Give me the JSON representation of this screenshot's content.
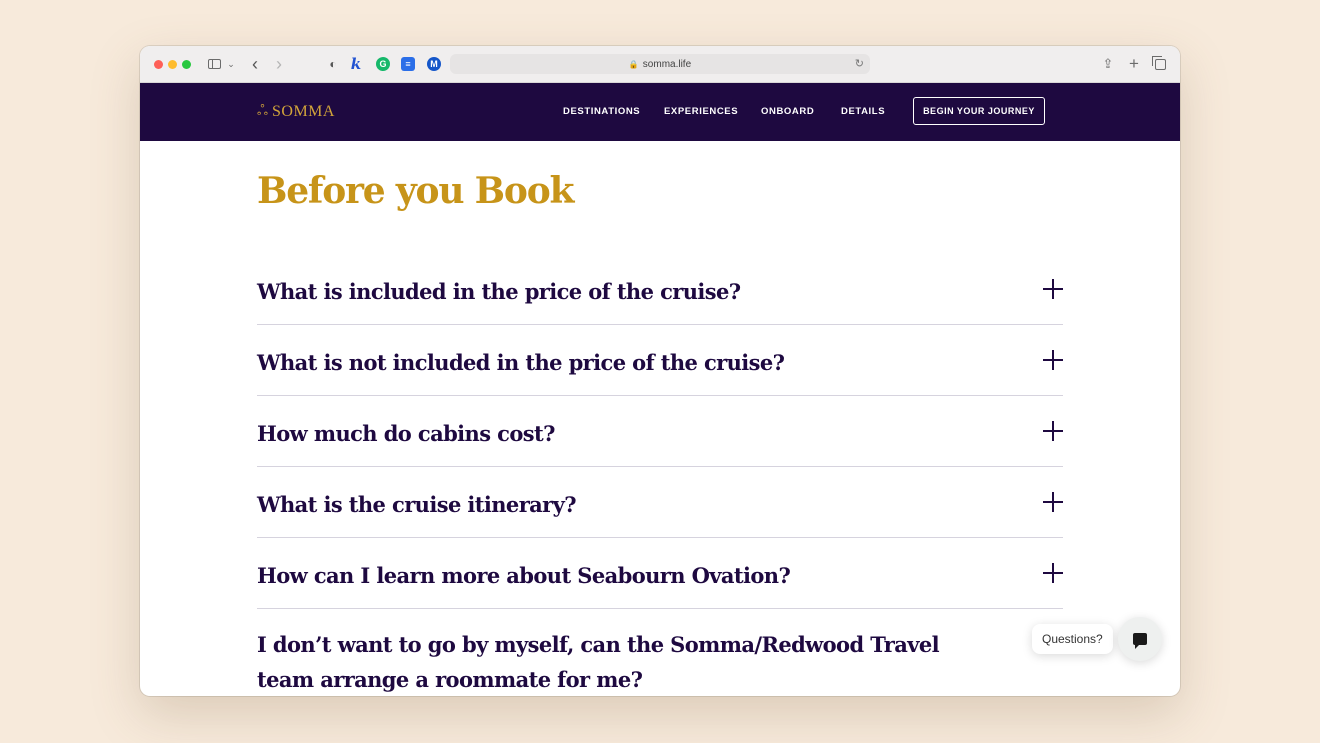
{
  "browser": {
    "url": "somma.life",
    "icons": [
      "sidebar-icon",
      "chevron-down-icon",
      "back-icon",
      "forward-icon",
      "shield-icon",
      "k-extension-icon",
      "grammarly-icon",
      "doc-extension-icon",
      "m-extension-icon",
      "lock-icon",
      "reload-icon",
      "share-icon",
      "plus-icon",
      "tabs-icon"
    ]
  },
  "nav": {
    "brand": "SOMMA",
    "links": [
      "DESTINATIONS",
      "EXPERIENCES",
      "ONBOARD",
      "DETAILS"
    ],
    "cta": "BEGIN YOUR JOURNEY"
  },
  "main": {
    "title": "Before you Book",
    "faqs": [
      "What is included in the price of the cruise?",
      "What is not included in the price of the cruise?",
      "How much do cabins cost?",
      "What is the cruise itinerary?",
      "How can I learn more about Seabourn Ovation?",
      "I don’t want to go by myself, can the Somma/Redwood Travel team arrange a roommate for me?"
    ]
  },
  "chat": {
    "label": "Questions?"
  },
  "colors": {
    "nav_bg": "#1e0940",
    "brand_gold": "#c79419",
    "text_dark": "#1e0940",
    "page_bg": "#f7eadb"
  }
}
